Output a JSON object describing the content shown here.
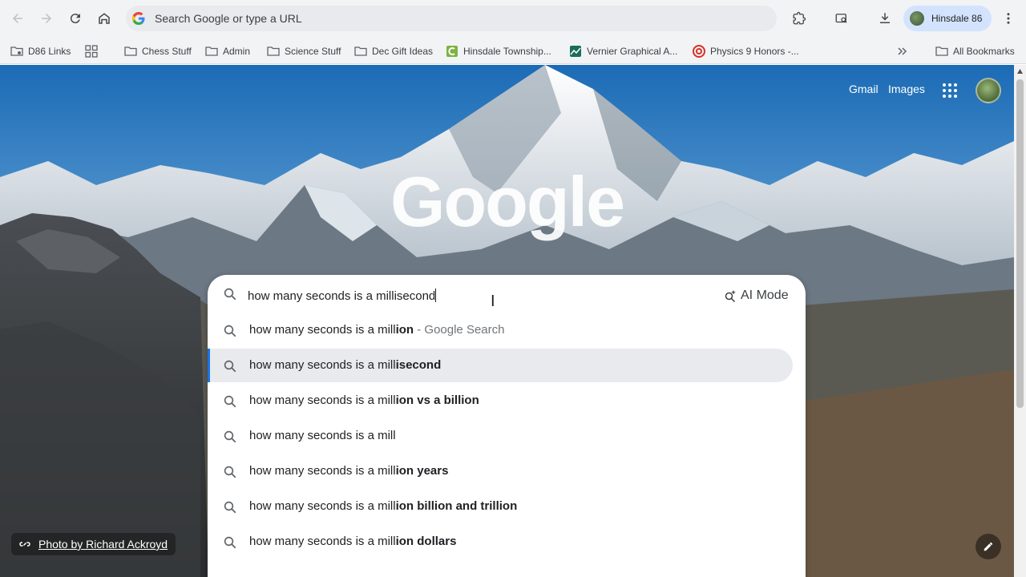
{
  "browser": {
    "omnibox_placeholder": "Search Google or type a URL",
    "profile_name": "Hinsdale 86"
  },
  "bookmarks": [
    {
      "label": "D86 Links",
      "icon": "gear-folder-icon"
    },
    {
      "label": "",
      "icon": "apps-grid-icon"
    },
    {
      "label": "Chess Stuff",
      "icon": "folder-icon"
    },
    {
      "label": "Admin",
      "icon": "folder-icon"
    },
    {
      "label": "Science Stuff",
      "icon": "folder-icon"
    },
    {
      "label": "Dec Gift Ideas",
      "icon": "folder-icon"
    },
    {
      "label": "Hinsdale Township...",
      "icon": "site-icon"
    },
    {
      "label": "Vernier Graphical A...",
      "icon": "site-icon"
    },
    {
      "label": "Physics 9 Honors -...",
      "icon": "site-icon"
    },
    {
      "label": "All Bookmarks",
      "icon": "folder-icon"
    }
  ],
  "page": {
    "logo": "Google",
    "gmail": "Gmail",
    "images": "Images",
    "photo_credit": "Photo by Richard Ackroyd"
  },
  "search": {
    "query": "how many seconds is a millisecond",
    "ai_mode": "AI Mode",
    "suggestions": [
      {
        "prefix": "how many seconds is a mill",
        "bold": "ion",
        "suffix": " - Google Search"
      },
      {
        "prefix": "how many seconds is a mill",
        "bold": "isecond",
        "suffix": ""
      },
      {
        "prefix": "how many seconds is a mill",
        "bold": "ion vs a billion",
        "suffix": ""
      },
      {
        "prefix": "how many seconds is a mill",
        "bold": "",
        "suffix": ""
      },
      {
        "prefix": "how many seconds is a mill",
        "bold": "ion years",
        "suffix": ""
      },
      {
        "prefix": "how many seconds is a mill",
        "bold": "ion billion and trillion",
        "suffix": ""
      },
      {
        "prefix": "how many seconds is a mill",
        "bold": "ion dollars",
        "suffix": ""
      }
    ],
    "selected_index": 1
  }
}
